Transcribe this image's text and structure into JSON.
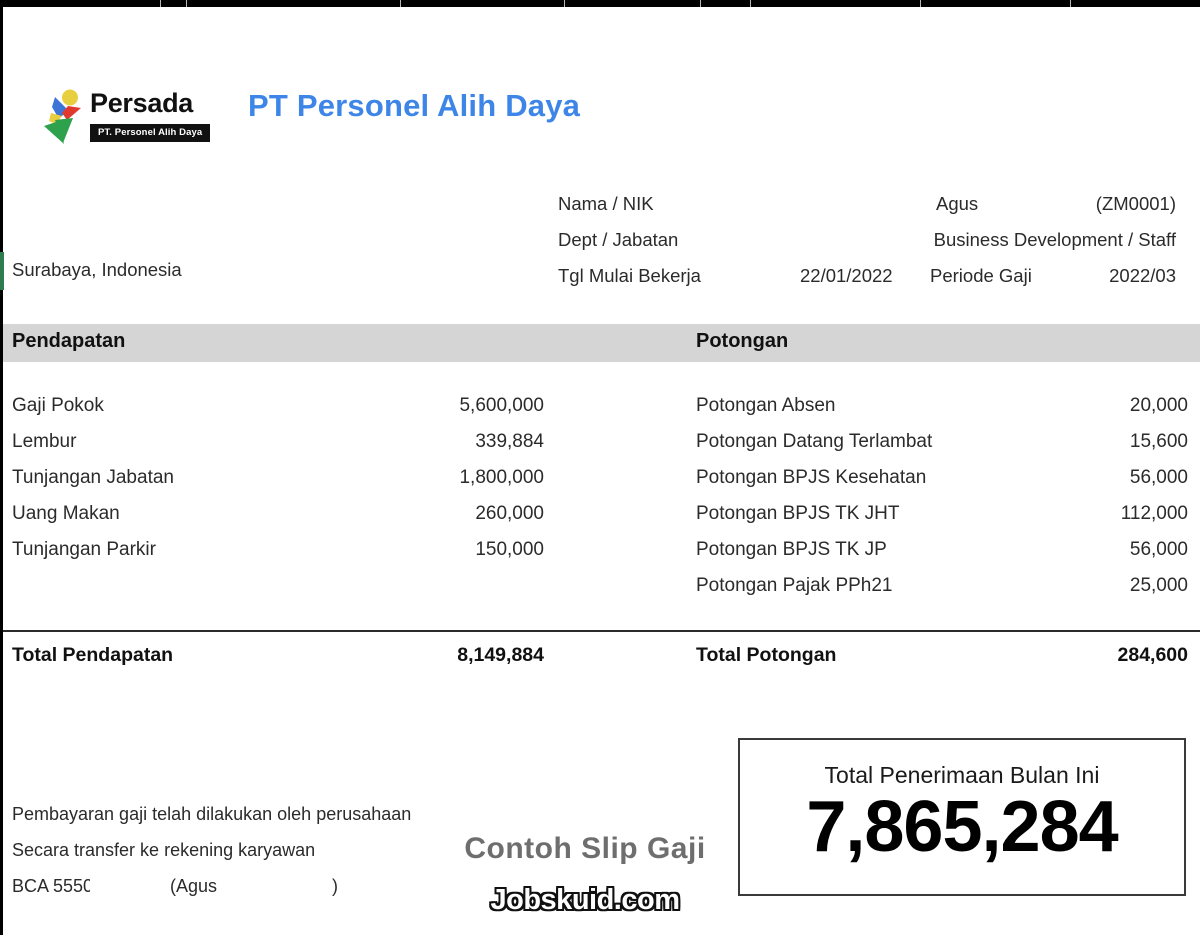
{
  "document": {
    "type": "payslip",
    "location": "Surabaya, Indonesia"
  },
  "brand": {
    "logo_name": "Persada",
    "logo_tagline": "PT. Personel Alih Daya",
    "company_title": "PT Personel Alih Daya",
    "accent_color": "#3d86e8"
  },
  "employee_info": {
    "rows": [
      {
        "label": "Nama / NIK",
        "value": "Agus",
        "extra": "(ZM0001)"
      },
      {
        "label": "Dept / Jabatan",
        "value": "Business Development / Staff",
        "extra": ""
      },
      {
        "label": "Tgl Mulai Bekerja",
        "value": "22/01/2022",
        "mid_label": "Periode Gaji",
        "extra": "2022/03"
      }
    ]
  },
  "sections": {
    "income_header": "Pendapatan",
    "deduction_header": "Potongan",
    "band_color": "#d5d5d5"
  },
  "income": {
    "items": [
      {
        "name": "Gaji Pokok",
        "amount": "5,600,000"
      },
      {
        "name": "Lembur",
        "amount": "339,884"
      },
      {
        "name": "Tunjangan Jabatan",
        "amount": "1,800,000"
      },
      {
        "name": "Uang Makan",
        "amount": "260,000"
      },
      {
        "name": "Tunjangan Parkir",
        "amount": "150,000"
      }
    ],
    "total_label": "Total Pendapatan",
    "total_amount": "8,149,884"
  },
  "deductions": {
    "items": [
      {
        "name": "Potongan Absen",
        "amount": "20,000"
      },
      {
        "name": "Potongan Datang Terlambat",
        "amount": "15,600"
      },
      {
        "name": "Potongan BPJS Kesehatan",
        "amount": "56,000"
      },
      {
        "name": "Potongan BPJS TK JHT",
        "amount": "112,000"
      },
      {
        "name": "Potongan BPJS TK JP",
        "amount": "56,000"
      },
      {
        "name": "Potongan Pajak PPh21",
        "amount": "25,000"
      }
    ],
    "total_label": "Total Potongan",
    "total_amount": "284,600"
  },
  "net_pay": {
    "label": "Total Penerimaan Bulan Ini",
    "amount": "7,865,284"
  },
  "footer": {
    "line1": "Pembayaran gaji telah dilakukan oleh perusahaan",
    "line2": "Secara transfer ke rekening karyawan",
    "bank": "BCA 5550",
    "account_open": "(Agus",
    "account_close": ")"
  },
  "watermarks": {
    "sample": "Contoh Slip Gaji",
    "site": "Jobskuid.com"
  }
}
